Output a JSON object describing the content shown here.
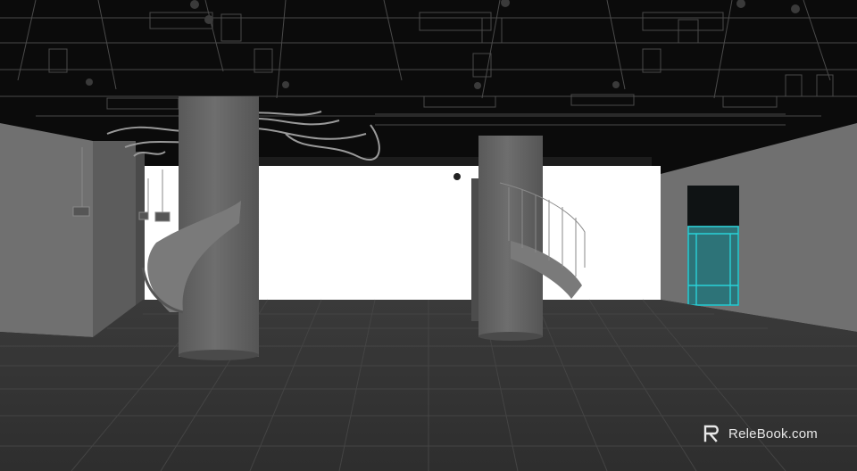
{
  "watermark": {
    "brand_text": "ReleBook.com",
    "logo_icon": "relebook-logo-icon"
  },
  "colors": {
    "ceiling": "#0b0b0b",
    "floor": "#373737",
    "wall": "#6d6d6d",
    "backlight": "#ffffff",
    "column": "#666666",
    "glass_accent": "#2ad1d8"
  }
}
